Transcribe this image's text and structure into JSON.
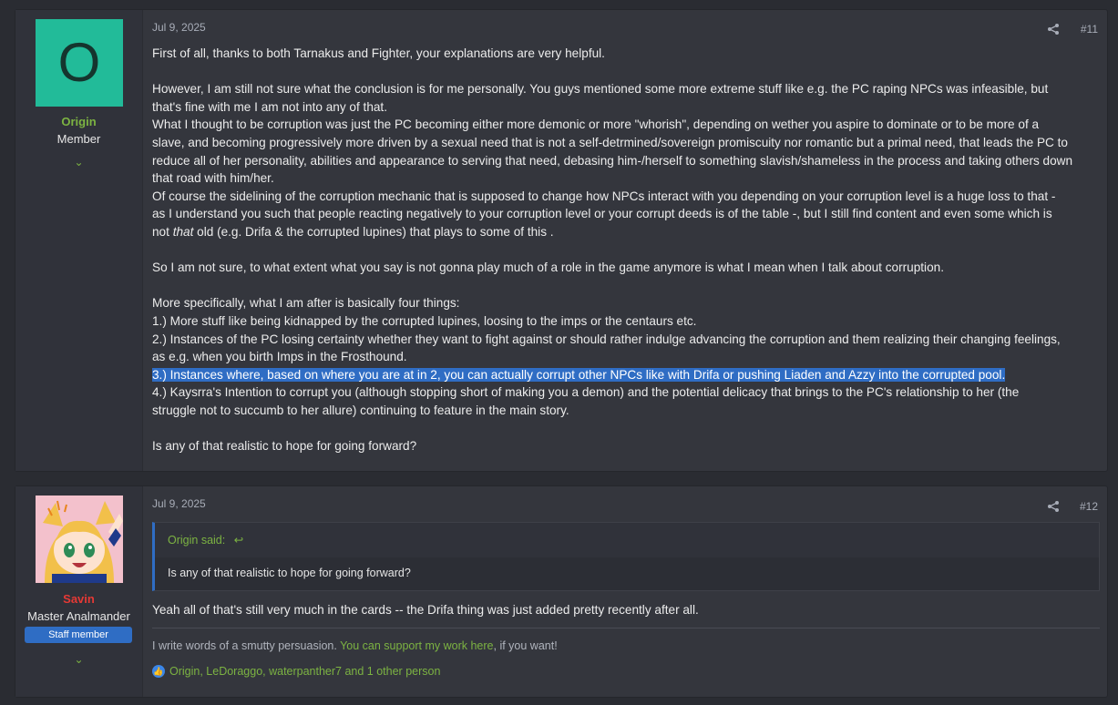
{
  "posts": [
    {
      "user": {
        "avatar_letter": "O",
        "name": "Origin",
        "name_color": "#7cb342",
        "title": "Member"
      },
      "date": "Jul 9, 2025",
      "number": "#11",
      "paragraphs": [
        "First of all, thanks to both Tarnakus and Fighter, your explanations are very helpful.",
        "However, I am still not sure what the conclusion is for me personally. You guys mentioned some more extreme stuff like e.g. the PC raping NPCs was infeasible, but",
        "that's fine with me I am not into any of that.",
        "What I thought to be corruption was just the PC becoming either more demonic or more \"whorish\", depending on wether you aspire to dominate or to be more of a",
        "slave, and becoming progressively more driven by a sexual need that is not a self-detrmined/sovereign promiscuity nor romantic but a primal need, that leads the PC to",
        "reduce all of her personality, abilities and appearance to serving that need, debasing him-/herself to something slavish/shameless in the process and taking others down",
        "that road with him/her.",
        "Of course the sidelining of the corruption mechanic that is supposed to change how NPCs interact with you depending on your corruption level is a huge loss to that -",
        "as I understand you such that people reacting negatively to your corruption level or your corrupt deeds is of the table -, but I still find content and even some which is",
        "So I am not sure, to what extent what you say is not gonna play much of a role in the game anymore is what I mean when I talk about corruption.",
        "More specifically, what I am after is basically four things:",
        "1.) More stuff like being kidnapped by the corrupted lupines, loosing to the imps or the centaurs etc.",
        "2.) Instances of the PC losing certainty whether they want to fight against or should rather indulge advancing the corruption and them realizing their changing feelings,",
        "as e.g. when you birth Imps in the Frosthound.",
        "3.) Instances where, based on where you are at in 2, you can actually corrupt other NPCs like with Drifa or pushing Liaden and Azzy into the corrupted pool.",
        "4.) Kaysrra's Intention to corrupt you (although stopping short of making you a demon) and the potential delicacy that brings to the PC's relationship to her (the",
        "struggle not to succumb to her allure) continuing to feature in the main story.",
        "Is any of that realistic to hope for going forward?"
      ],
      "line_not_prefix": "not ",
      "line_not_italic": "that",
      "line_not_suffix": " old (e.g. Drifa & the corrupted lupines) that plays to some of this ."
    },
    {
      "user": {
        "name": "Savin",
        "name_color": "#e53935",
        "title": "Master Analmander",
        "badge": "Staff member"
      },
      "date": "Jul 9, 2025",
      "number": "#12",
      "quote_author": "Origin said:",
      "quote_text": "Is any of that realistic to hope for going forward?",
      "reply": "Yeah all of that's still very much in the cards -- the Drifa thing was just added pretty recently after all.",
      "signature_prefix": "I write words of a smutty persuasion. ",
      "signature_link": "You can support my work here",
      "signature_suffix": ", if you want!",
      "reactions": "Origin, LeDoraggo, waterpanther7 and 1 other person"
    }
  ]
}
